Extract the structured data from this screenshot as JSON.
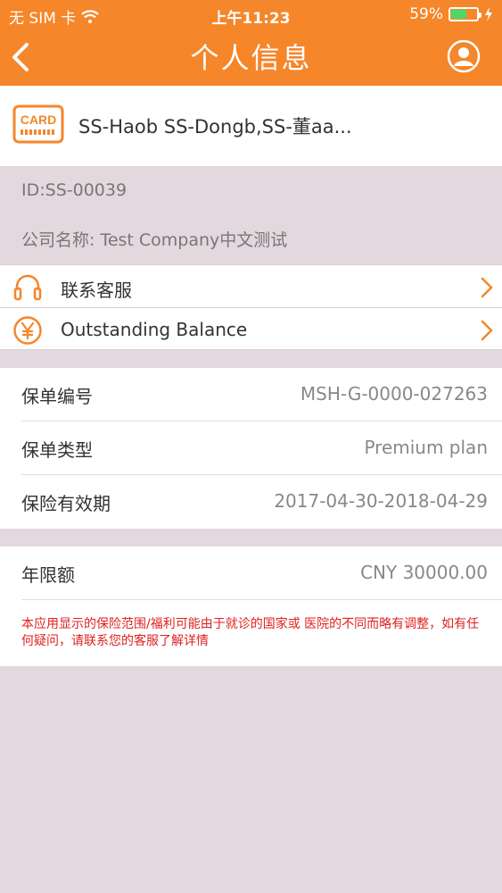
{
  "status_bar": {
    "carrier": "无 SIM 卡",
    "time": "上午11:23",
    "battery_percent": "59%",
    "battery_level": 0.59
  },
  "nav": {
    "title": "个人信息",
    "back_icon": "chevron-left-icon",
    "profile_icon": "user-circle-icon"
  },
  "card": {
    "icon_label": "CARD",
    "member_names": "SS-Haob SS-Dongb,SS-董aa..."
  },
  "info": {
    "id": "ID:SS-00039",
    "company_label": "公司名称:",
    "company_name": "Test Company中文测试"
  },
  "menu": [
    {
      "label": "联系客服",
      "icon": "headset-icon"
    },
    {
      "label": "Outstanding Balance",
      "icon": "yen-icon"
    }
  ],
  "policy": [
    {
      "label": "保单编号",
      "value": "MSH-G-0000-027263"
    },
    {
      "label": "保单类型",
      "value": "Premium plan"
    },
    {
      "label": "保险有效期",
      "value": "2017-04-30-2018-04-29"
    }
  ],
  "limit": {
    "label": "年限额",
    "value": "CNY 30000.00",
    "disclaimer": "本应用显示的保险范围/福利可能由于就诊的国家或 医院的不同而略有调整，如有任何疑问，请联系您的客服了解详情"
  },
  "colors": {
    "accent": "#f5862a",
    "background": "#e3d8de",
    "warning_text": "#e02020"
  }
}
